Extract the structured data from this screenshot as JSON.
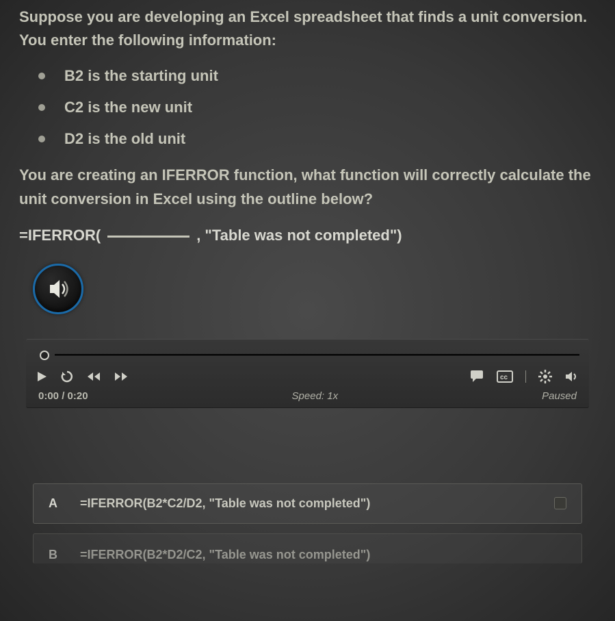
{
  "question": {
    "intro": "Suppose you are developing an Excel spreadsheet that finds a unit conversion. You enter the following information:",
    "bullets": [
      "B2 is the starting unit",
      "C2 is the new unit",
      "D2 is the old unit"
    ],
    "prompt": "You are creating an IFERROR function, what function will correctly calculate the unit conversion in Excel using the outline below?",
    "formula_pre": "=IFERROR(",
    "formula_post": ", \"Table was not completed\")"
  },
  "player": {
    "time": "0:00 / 0:20",
    "speed": "Speed: 1x",
    "status": "Paused"
  },
  "answers": [
    {
      "letter": "A",
      "text": "=IFERROR(B2*C2/D2, \"Table was not completed\")"
    },
    {
      "letter": "B",
      "text": "=IFERROR(B2*D2/C2, \"Table was not completed\")"
    }
  ]
}
